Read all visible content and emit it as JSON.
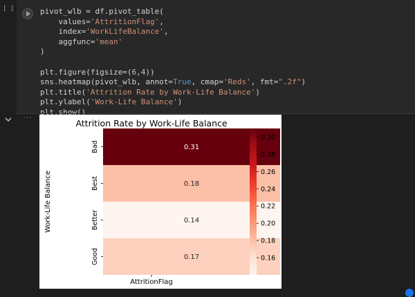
{
  "cell": {
    "execution_count": "[ ]",
    "code_lines": [
      "pivot_wlb = df.pivot_table(",
      "    values='AttritionFlag',",
      "    index='WorkLifeBalance',",
      "    aggfunc='mean'",
      ")",
      "",
      "plt.figure(figsize=(6,4))",
      "sns.heatmap(pivot_wlb, annot=True, cmap='Reds', fmt=\".2f\")",
      "plt.title('Attrition Rate by Work-Life Balance')",
      "plt.ylabel('Work-Life Balance')",
      "plt.show()"
    ]
  },
  "output": {
    "menu_glyph": "···"
  },
  "chart_data": {
    "type": "heatmap",
    "title": "Attrition Rate by Work-Life Balance",
    "xlabel": "AttritionFlag",
    "ylabel": "Work-Life Balance",
    "rows": [
      "Bad",
      "Best",
      "Better",
      "Good"
    ],
    "columns": [
      ""
    ],
    "values": [
      0.31,
      0.18,
      0.14,
      0.17
    ],
    "annotations": [
      "0.31",
      "0.18",
      "0.14",
      "0.17"
    ],
    "colormap": "Reds",
    "colorbar_range": [
      0.14,
      0.31
    ],
    "colorbar_ticks": [
      "0.30",
      "0.28",
      "0.26",
      "0.24",
      "0.22",
      "0.20",
      "0.18",
      "0.16"
    ],
    "colorbar_tick_values": [
      0.3,
      0.28,
      0.26,
      0.24,
      0.22,
      0.2,
      0.18,
      0.16
    ]
  }
}
